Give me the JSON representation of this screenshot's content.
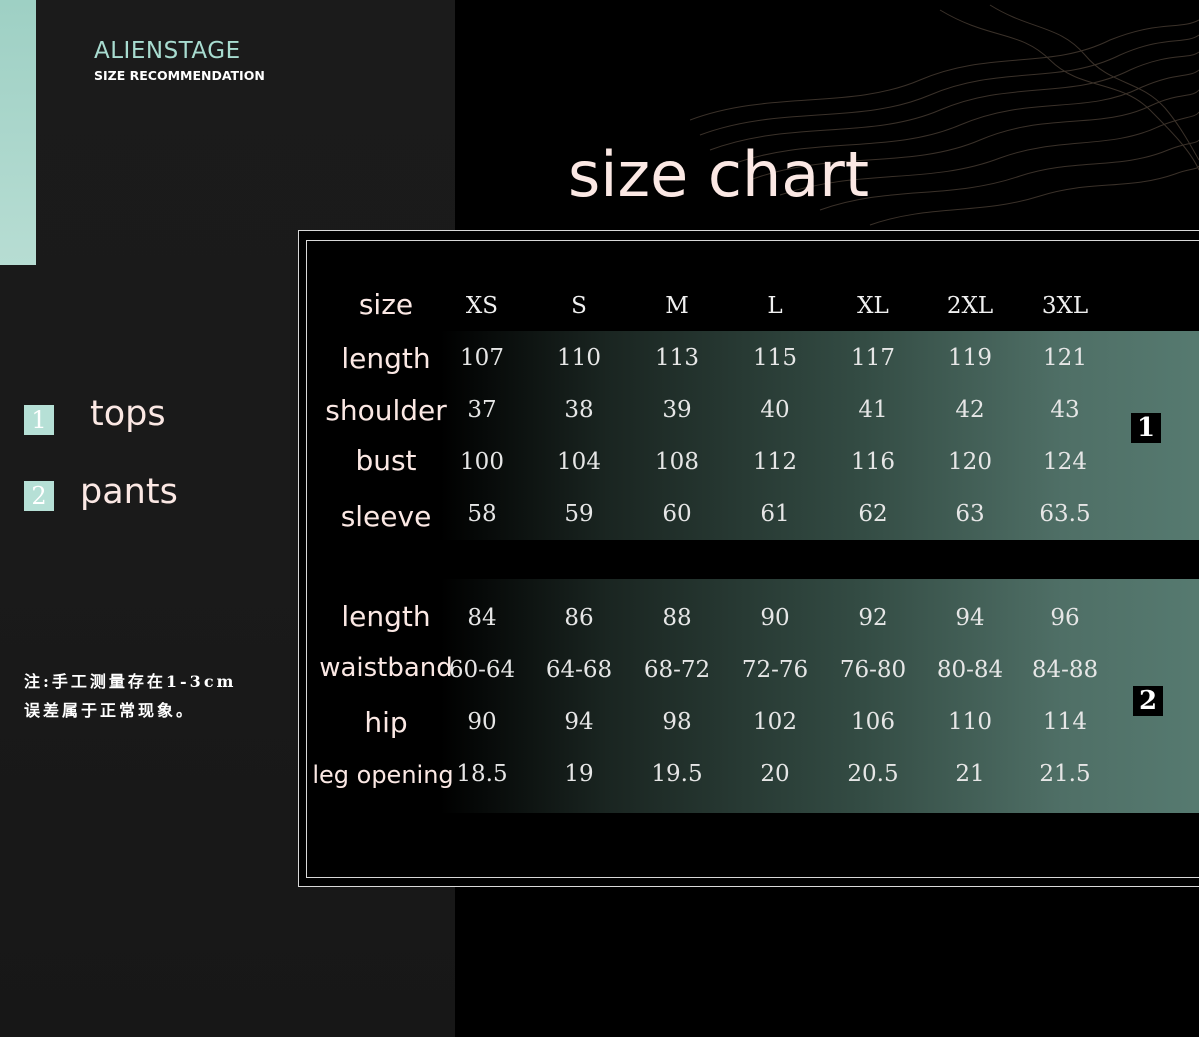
{
  "brand": {
    "name": "ALIENSTAGE",
    "subtitle": "SIZE RECOMMENDATION"
  },
  "title": "size chart",
  "legend": [
    {
      "badge": "1",
      "label": "tops"
    },
    {
      "badge": "2",
      "label": "pants"
    }
  ],
  "note": [
    "注:手工测量存在1-3cm",
    "误差属于正常现象。"
  ],
  "header": {
    "label": "size",
    "sizes": [
      "XS",
      "S",
      "M",
      "L",
      "XL",
      "2XL",
      "3XL"
    ]
  },
  "sections": [
    {
      "badge": "1",
      "rows": [
        {
          "label": "length",
          "values": [
            "107",
            "110",
            "113",
            "115",
            "117",
            "119",
            "121"
          ]
        },
        {
          "label": "shoulder",
          "values": [
            "37",
            "38",
            "39",
            "40",
            "41",
            "42",
            "43"
          ]
        },
        {
          "label": "bust",
          "values": [
            "100",
            "104",
            "108",
            "112",
            "116",
            "120",
            "124"
          ]
        },
        {
          "label": "sleeve",
          "values": [
            "58",
            "59",
            "60",
            "61",
            "62",
            "63",
            "63.5"
          ]
        }
      ]
    },
    {
      "badge": "2",
      "rows": [
        {
          "label": "length",
          "values": [
            "84",
            "86",
            "88",
            "90",
            "92",
            "94",
            "96"
          ]
        },
        {
          "label": "waistband",
          "values": [
            "60-64",
            "64-68",
            "68-72",
            "72-76",
            "76-80",
            "80-84",
            "84-88"
          ]
        },
        {
          "label": "hip",
          "values": [
            "90",
            "94",
            "98",
            "102",
            "106",
            "110",
            "114"
          ]
        },
        {
          "label": "leg opening",
          "values": [
            "18.5",
            "19",
            "19.5",
            "20",
            "20.5",
            "21",
            "21.5"
          ]
        }
      ]
    }
  ],
  "colors": {
    "accent": "#b6e0d6",
    "brand": "#a8dcd0",
    "title": "#fbe8e4",
    "band": "#567a70"
  }
}
